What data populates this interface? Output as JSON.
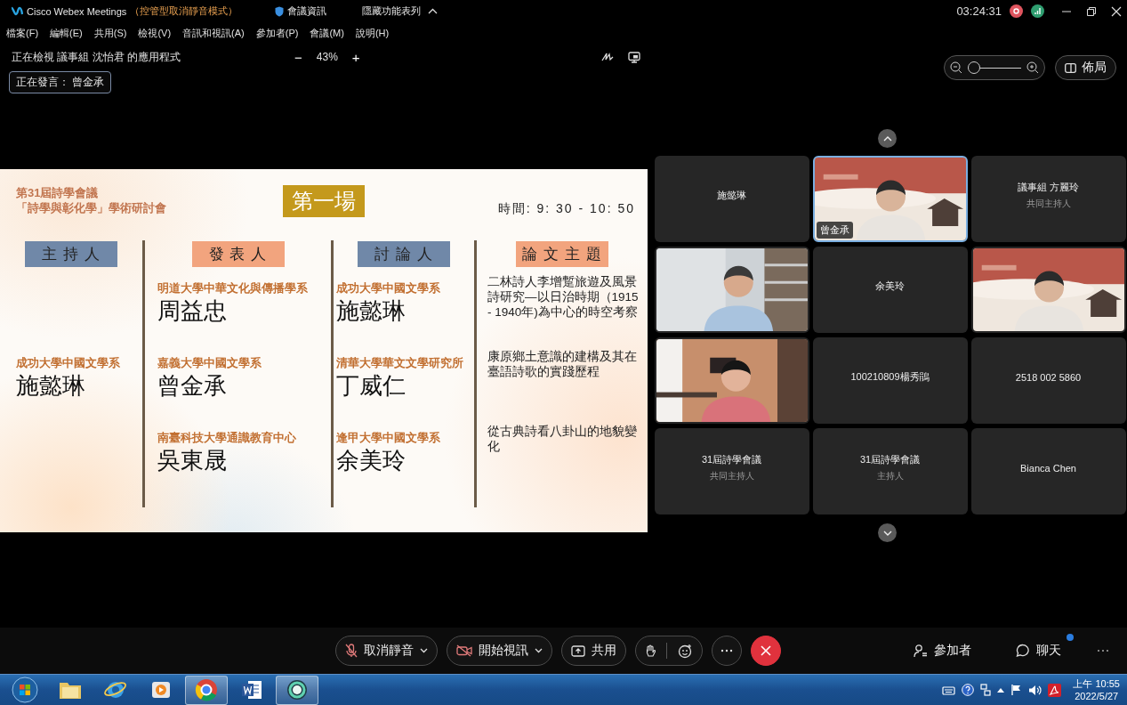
{
  "window": {
    "app_name": "Cisco Webex Meetings",
    "mode": "（控管型取消靜音模式）",
    "meeting_info": "會議資訊",
    "hide_menu": "隱藏功能表列",
    "timer": "03:24:31"
  },
  "menu": [
    "檔案(F)",
    "編輯(E)",
    "共用(S)",
    "檢視(V)",
    "音訊和視訊(A)",
    "參加者(P)",
    "會議(M)",
    "說明(H)"
  ],
  "share_bar": {
    "viewing": "正在檢視 議事組 沈怡君 的應用程式",
    "zoom_out": "−",
    "zoom": "43%",
    "zoom_in": "+",
    "speaking": "正在發言： 曾金承"
  },
  "view_controls": {
    "level": 0.0,
    "layout": "佈局"
  },
  "slide": {
    "title_lines": [
      "第31屆詩學會議",
      "「詩學與彰化學」學術研討會"
    ],
    "session": "第一場",
    "time": "時間: 9: 30 - 10: 50",
    "columns": [
      {
        "kind": "people",
        "header": "主 持 人",
        "color": "#7088a8",
        "entries": [
          {
            "affiliation": "成功大學中國文學系",
            "name": "施懿琳"
          }
        ]
      },
      {
        "kind": "people",
        "header": "發 表 人",
        "color": "#f2a47e",
        "entries": [
          {
            "affiliation": "明道大學中華文化與傳播學系",
            "name": "周益忠"
          },
          {
            "affiliation": "嘉義大學中國文學系",
            "name": "曾金承"
          },
          {
            "affiliation": "南臺科技大學通識教育中心",
            "name": "吳東晟"
          }
        ]
      },
      {
        "kind": "people",
        "header": "討 論 人",
        "color": "#7088a8",
        "entries": [
          {
            "affiliation": "成功大學中國文學系",
            "name": "施懿琳"
          },
          {
            "affiliation": "清華大學華文文學研究所",
            "name": "丁威仁"
          },
          {
            "affiliation": "逢甲大學中國文學系",
            "name": "余美玲"
          }
        ]
      },
      {
        "kind": "topics",
        "header": "論 文 主 題",
        "color": "#f2a47e",
        "entries": [
          {
            "topic": "二林詩人李增蹔旅遊及風景詩研究—以日治時期（1915 - 1940年)為中心的時空考察"
          },
          {
            "topic": "康原鄉土意識的建構及其在臺語詩歌的實踐歷程"
          },
          {
            "topic": "從古典詩看八卦山的地貌變化"
          }
        ]
      }
    ]
  },
  "participants": [
    {
      "kind": "name",
      "name": "施懿琳",
      "speaking": false
    },
    {
      "kind": "video",
      "name": "曾金承",
      "speaking": true
    },
    {
      "kind": "name",
      "name": "議事組 方麗玲",
      "role": "共同主持人",
      "speaking": false
    },
    {
      "kind": "video",
      "speaking": false
    },
    {
      "kind": "name",
      "name": "余美玲",
      "speaking": false
    },
    {
      "kind": "video",
      "speaking": false
    },
    {
      "kind": "video",
      "speaking": false
    },
    {
      "kind": "name",
      "name": "100210809楊秀鵑",
      "speaking": false
    },
    {
      "kind": "name",
      "name": "2518 002 5860",
      "speaking": false
    },
    {
      "kind": "name",
      "name": "31屆詩學會議",
      "role": "共同主持人",
      "speaking": false
    },
    {
      "kind": "name",
      "name": "31屆詩學會議",
      "role": "主持人",
      "speaking": false
    },
    {
      "kind": "name",
      "name": "Bianca Chen",
      "speaking": false
    }
  ],
  "toolbar": {
    "mute": {
      "label": "取消靜音",
      "muted": true
    },
    "video": {
      "label": "開始視訊",
      "off": true
    },
    "share": "共用",
    "participants": "參加者",
    "chat": {
      "label": "聊天",
      "unread": true
    }
  },
  "taskbar": {
    "apps": [
      {
        "kind": "start",
        "running": false
      },
      {
        "kind": "folder",
        "running": false
      },
      {
        "kind": "globe",
        "running": false
      },
      {
        "kind": "media",
        "running": false
      },
      {
        "kind": "browser",
        "running": true
      },
      {
        "kind": "document",
        "running": false
      },
      {
        "kind": "meeting",
        "running": true
      }
    ],
    "clock": {
      "time": "上午 10:55",
      "date": "2022/5/27"
    }
  }
}
